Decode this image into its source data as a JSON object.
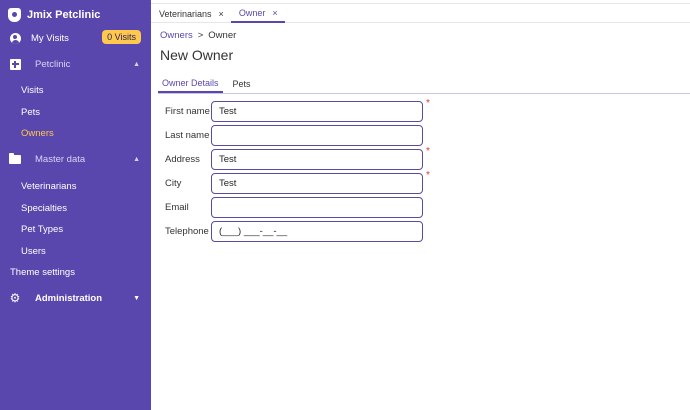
{
  "app": {
    "title": "Jmix Petclinic"
  },
  "sidebar": {
    "my_visits": {
      "label": "My Visits",
      "badge": "0 Visits"
    },
    "petclinic": {
      "label": "Petclinic",
      "items": [
        "Visits",
        "Pets",
        "Owners"
      ]
    },
    "master_data": {
      "label": "Master data",
      "items": [
        "Veterinarians",
        "Specialties",
        "Pet Types",
        "Users"
      ]
    },
    "theme_settings": "Theme settings",
    "administration": "Administration",
    "active_item": "Owners"
  },
  "tabs": [
    {
      "label": "Veterinarians",
      "close": "×"
    },
    {
      "label": "Owner",
      "close": "×",
      "selected": true
    }
  ],
  "breadcrumb": {
    "parent": "Owners",
    "separator": ">",
    "current": "Owner"
  },
  "page_title": "New Owner",
  "form_tabs": [
    "Owner Details",
    "Pets"
  ],
  "form": {
    "first_name": {
      "label": "First name",
      "value": "Test",
      "required": "*"
    },
    "last_name": {
      "label": "Last name",
      "value": ""
    },
    "address": {
      "label": "Address",
      "value": "Test",
      "required": "*"
    },
    "city": {
      "label": "City",
      "value": "Test",
      "required": "*"
    },
    "email": {
      "label": "Email",
      "value": ""
    },
    "telephone": {
      "label": "Telephone",
      "value": "(___) ___-__-__"
    }
  },
  "colors": {
    "sidebar": "#5a47ad",
    "accent": "#5a47ad",
    "highlight": "#ffc94d",
    "required": "#e0342f"
  }
}
